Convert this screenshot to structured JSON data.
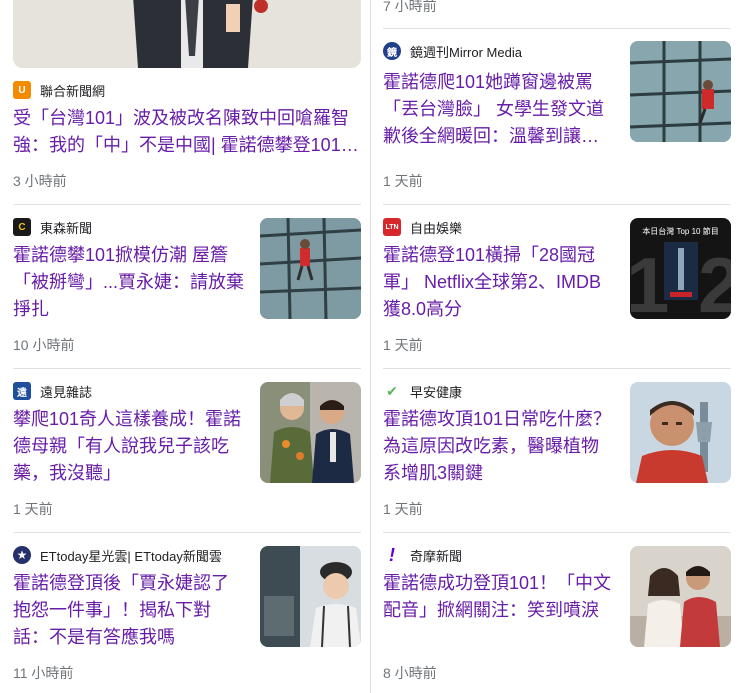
{
  "left": {
    "top_card": {
      "source": "聯合新聞網",
      "title": "受「台灣101」波及被改名陳致中回嗆羅智強：我的「中」不是中國| 霍諾德攀登101 …",
      "time": "3 小時前"
    },
    "cards": [
      {
        "source": "東森新聞",
        "title": "霍諾德攀101掀模仿潮 屋簷「被掰彎」...賈永婕：請放棄掙扎",
        "time": "10 小時前"
      },
      {
        "source": "遠見雜誌",
        "title": "攀爬101奇人這樣養成！霍諾德母親「有人說我兒子該吃藥，我沒聽」",
        "time": "1 天前"
      },
      {
        "source": "ETtoday星光雲| ETtoday新聞雲",
        "title": "霍諾德登頂後「賈永婕認了抱怨一件事」！揭私下對話：不是有答應我嗎",
        "time": "11 小時前"
      }
    ]
  },
  "right": {
    "top_time": "7 小時前",
    "cards": [
      {
        "source": "鏡週刊Mirror Media",
        "title": "霍諾德爬101她蹲窗邊被罵「丟台灣臉」 女學生發文道歉後全網暖回：溫馨到讓人…",
        "time": "1 天前"
      },
      {
        "source": "自由娛樂",
        "title": "霍諾德登101橫掃「28國冠軍」 Netflix全球第2、IMDB獲8.0高分",
        "time": "1 天前",
        "thumb_text": "本日台灣 Top 10 節目"
      },
      {
        "source": "早安健康",
        "title": "霍諾德攻頂101日常吃什麼？為這原因改吃素，醫曝植物系增肌3關鍵",
        "time": "1 天前"
      },
      {
        "source": "奇摩新聞",
        "title": "霍諾德成功登頂101！「中文配音」掀網關注：笑到噴淚",
        "time": "8 小時前"
      }
    ]
  },
  "icons": {
    "udn": "U",
    "ebc": "C",
    "gvm": "遠",
    "ettoday": "★",
    "mirror": "鏡",
    "ltn": "LTN",
    "morning": "✔",
    "yahoo": "!"
  },
  "colors": {
    "title": "#681da8",
    "meta": "#70757a"
  }
}
